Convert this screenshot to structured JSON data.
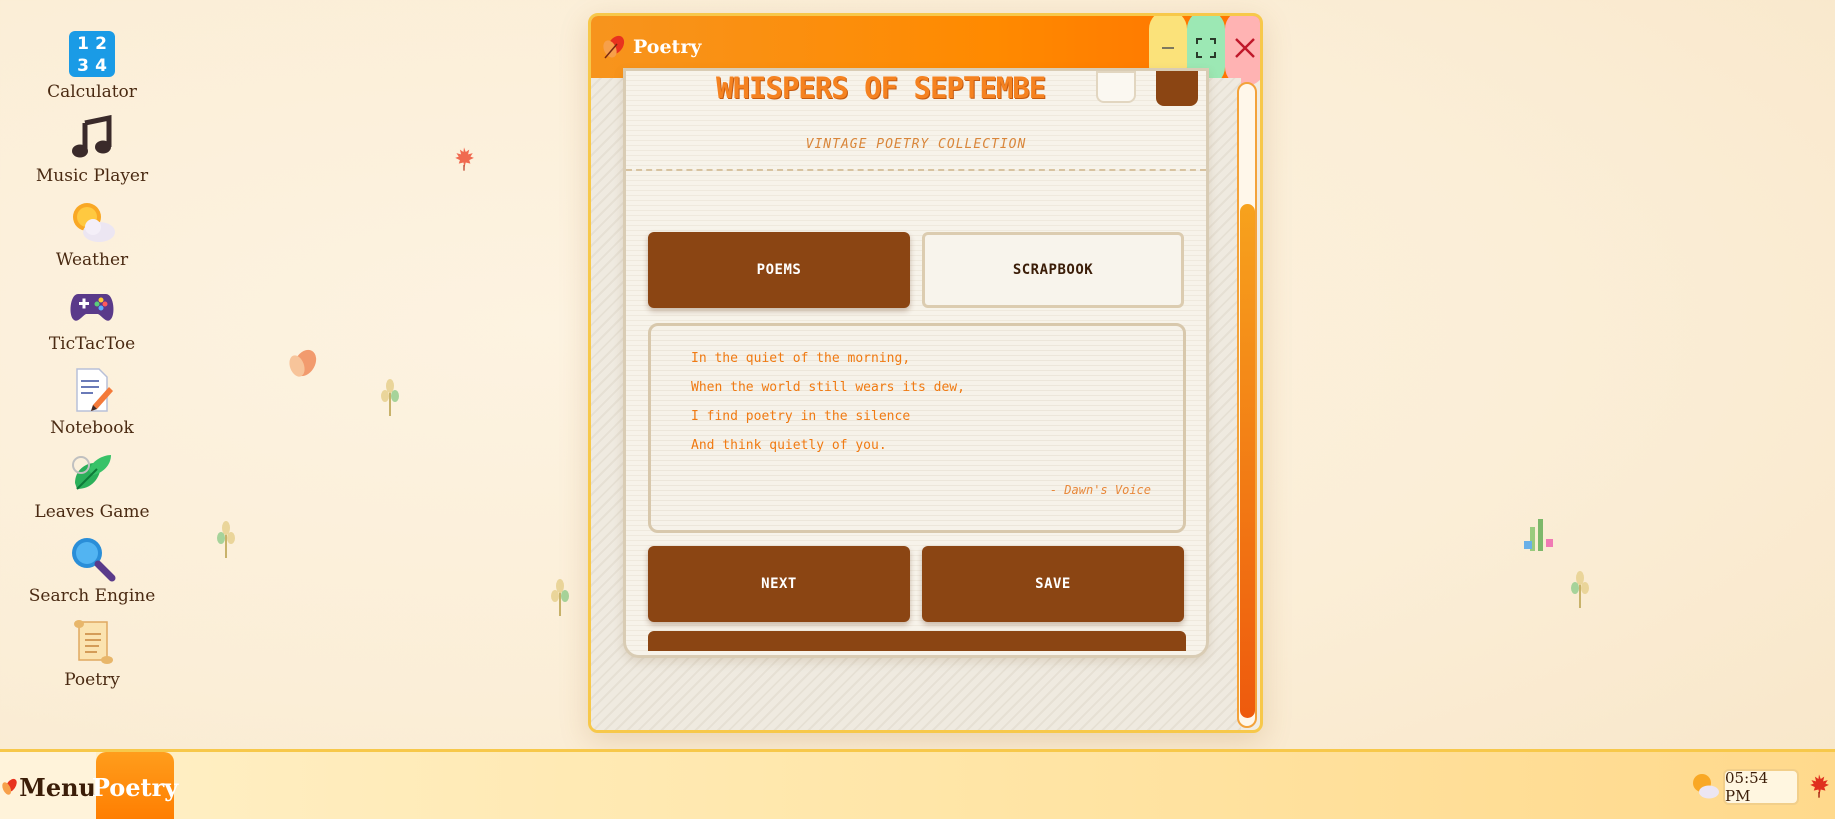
{
  "desktop": {
    "icons": [
      {
        "label": "Calculator",
        "icon": "calculator-icon"
      },
      {
        "label": "Music Player",
        "icon": "music-note-icon"
      },
      {
        "label": "Weather",
        "icon": "sun-cloud-icon"
      },
      {
        "label": "TicTacToe",
        "icon": "gamepad-icon"
      },
      {
        "label": "Notebook",
        "icon": "notebook-icon"
      },
      {
        "label": "Leaves Game",
        "icon": "leaves-icon"
      },
      {
        "label": "Search Engine",
        "icon": "magnifier-icon"
      },
      {
        "label": "Poetry",
        "icon": "scroll-icon"
      }
    ],
    "calculator_digits": [
      "1",
      "2",
      "3",
      "4"
    ]
  },
  "window": {
    "title": "Poetry",
    "heading": "WHISPERS OF SEPTEMBE",
    "subtitle": "VINTAGE POETRY COLLECTION",
    "tabs": {
      "poems": "POEMS",
      "scrapbook": "SCRAPBOOK"
    },
    "poem": {
      "lines": [
        "In the quiet of the morning,",
        "When the world still wears its dew,",
        "I find poetry in the silence",
        "And think quietly of you."
      ],
      "author": "- Dawn's Voice"
    },
    "actions": {
      "next": "NEXT",
      "save": "SAVE"
    }
  },
  "taskbar": {
    "menu_label": "Menu",
    "active_app": "Poetry",
    "clock": "05:54 PM"
  },
  "colors": {
    "accent": "#ff8a00",
    "brown": "#8b4513",
    "poem_text": "#f07a12",
    "taskbar_border": "#f7c84a"
  }
}
